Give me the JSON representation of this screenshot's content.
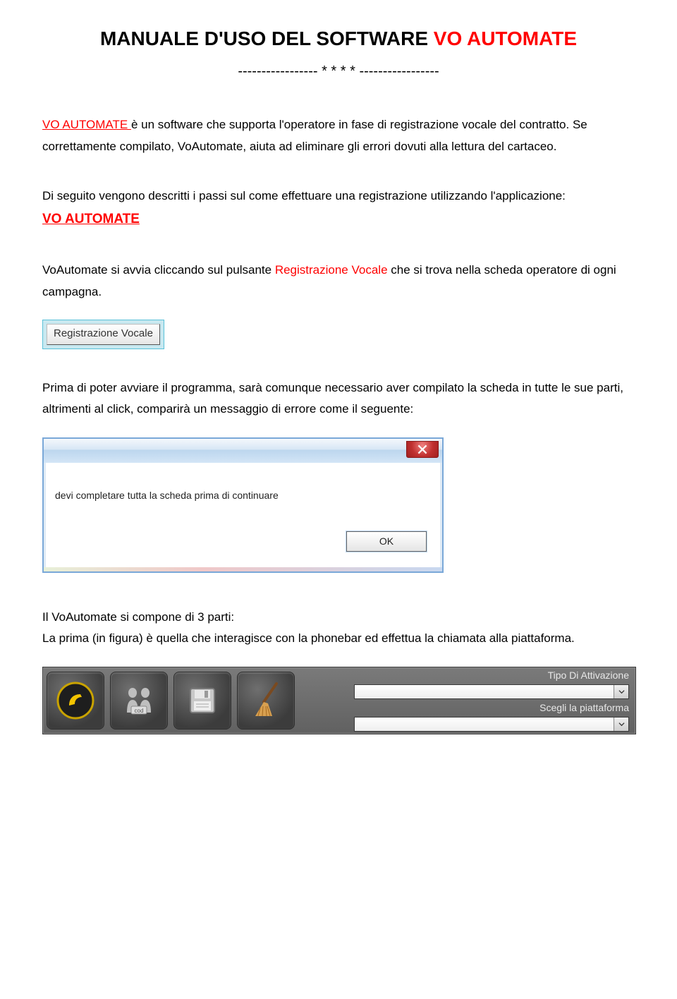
{
  "title_prefix": "MANUALE D'USO DEL SOFTWARE ",
  "title_red": "VO AUTOMATE",
  "separator": "----------------- * * * * -----------------",
  "p1_a": "VO AUTOMATE ",
  "p1_b": "è un software che supporta l'operatore in fase di registrazione vocale del contratto. Se correttamente compilato, VoAutomate, aiuta ad eliminare gli errori dovuti alla lettura del cartaceo.",
  "p2": "Di seguito vengono descritti i passi sul come effettuare una registrazione utilizzando l'applicazione:",
  "p2_link": "VO AUTOMATE",
  "p3_a": "VoAutomate si avvia cliccando sul pulsante ",
  "p3_red": "Registrazione Vocale",
  "p3_b": " che si trova nella scheda operatore di ogni campagna.",
  "reg_button_label": "Registrazione Vocale",
  "p4": " Prima di poter avviare il programma, sarà comunque necessario aver compilato la scheda in tutte le sue parti, altrimenti al click, comparirà un messaggio di errore come il seguente:",
  "dialog": {
    "message": "devi completare tutta la scheda prima di continuare",
    "ok": "OK"
  },
  "p5": "Il VoAutomate si compone di 3 parti:",
  "p6": "La prima (in figura) è quella che interagisce con la phonebar ed effettua la chiamata alla piattaforma.",
  "toolbar": {
    "label_attivazione": "Tipo Di Attivazione",
    "label_piattaforma": "Scegli la piattaforma"
  }
}
